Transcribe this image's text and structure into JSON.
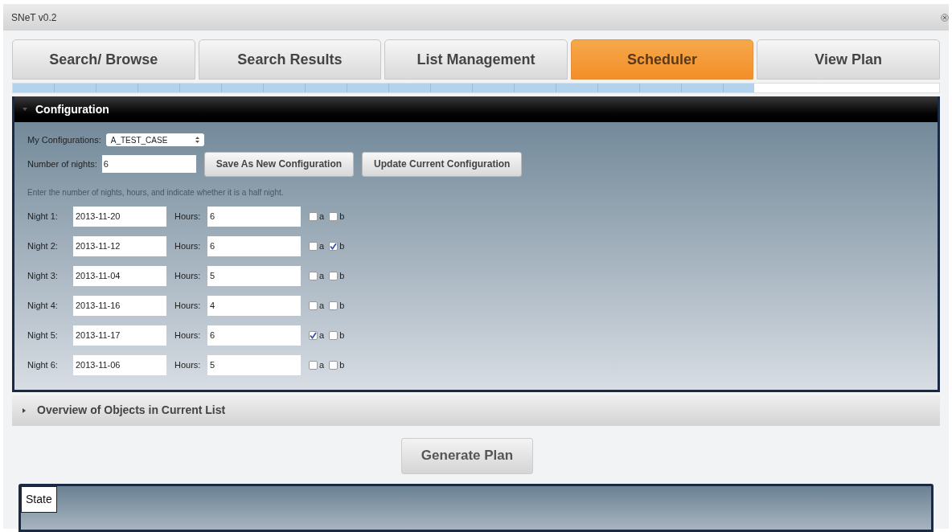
{
  "window": {
    "title": "SNeT v0.2"
  },
  "tabs": [
    {
      "label": "Search/ Browse",
      "selected": false
    },
    {
      "label": "Search Results",
      "selected": false
    },
    {
      "label": "List Management",
      "selected": false
    },
    {
      "label": "Scheduler",
      "selected": true
    },
    {
      "label": "View Plan",
      "selected": false
    }
  ],
  "progress": {
    "level": 0.8
  },
  "configuration": {
    "title": "Configuration",
    "expanded": true,
    "my_configurations_label": "My Configurations:",
    "my_configurations_value": "A_TEST_CASE",
    "nights_label": "Number of nights:",
    "nights_value": "6",
    "buttons": [
      "Save As New Configuration",
      "Update Current Configuration"
    ],
    "hint": "Enter the number of nights, hours, and indicate whether it is a half night.",
    "nights": [
      {
        "label": "Night 1:",
        "date": "2013-11-20",
        "hours_label": "Hours:",
        "hours": "6",
        "a_label": "a",
        "a": false,
        "b_label": "b",
        "b": false
      },
      {
        "label": "Night 2:",
        "date": "2013-11-12",
        "hours_label": "Hours:",
        "hours": "6",
        "a_label": "a",
        "a": false,
        "b_label": "b",
        "b": true
      },
      {
        "label": "Night 3:",
        "date": "2013-11-04",
        "hours_label": "Hours:",
        "hours": "5",
        "a_label": "a",
        "a": false,
        "b_label": "b",
        "b": false
      },
      {
        "label": "Night 4:",
        "date": "2013-11-16",
        "hours_label": "Hours:",
        "hours": "4",
        "a_label": "a",
        "a": false,
        "b_label": "b",
        "b": false
      },
      {
        "label": "Night 5:",
        "date": "2013-11-17",
        "hours_label": "Hours:",
        "hours": "6",
        "a_label": "a",
        "a": true,
        "b_label": "b",
        "b": false
      },
      {
        "label": "Night 6:",
        "date": "2013-11-06",
        "hours_label": "Hours:",
        "hours": "5",
        "a_label": "a",
        "a": false,
        "b_label": "b",
        "b": false
      }
    ]
  },
  "overview": {
    "title": "Overview of Objects in Current List",
    "expanded": false
  },
  "generate_button": "Generate Plan",
  "state_panel": {
    "title": "State"
  }
}
